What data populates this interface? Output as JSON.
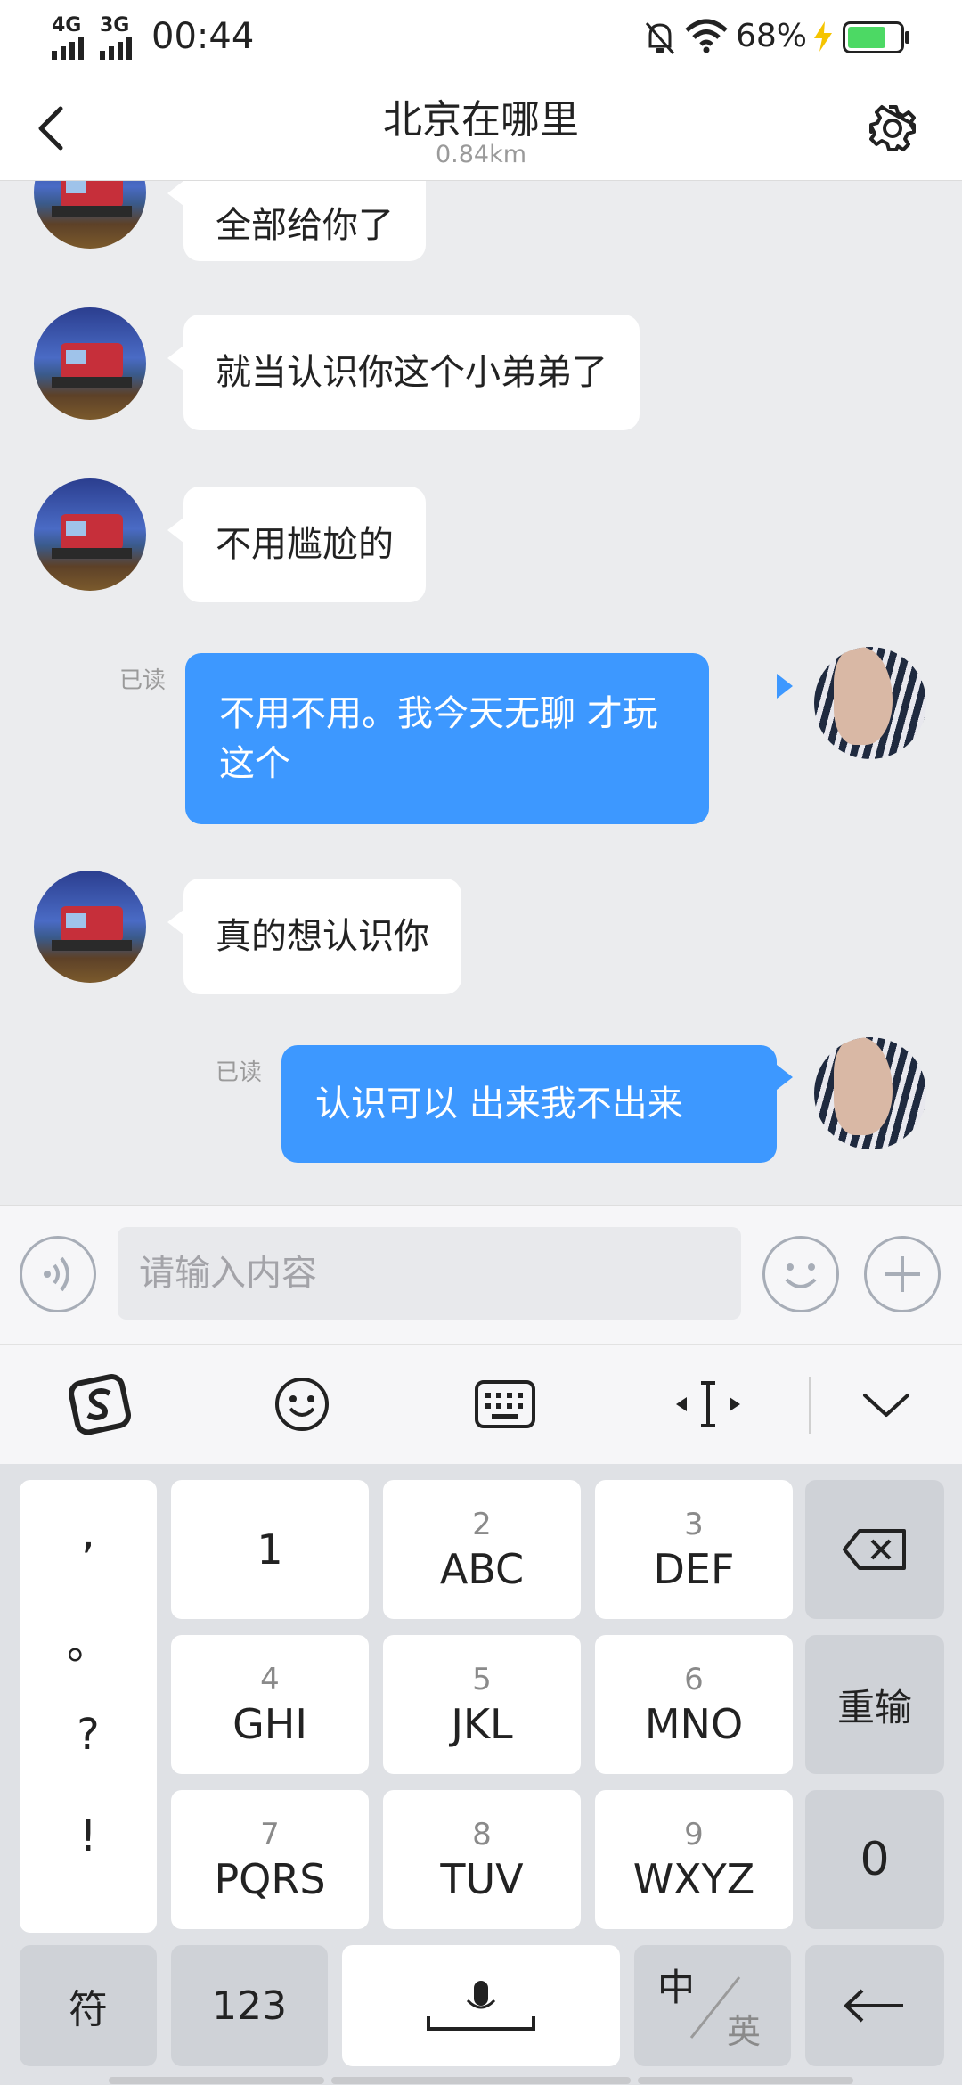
{
  "status_bar": {
    "signal1": "4G",
    "signal2": "3G",
    "time": "00:44",
    "battery_percent": "68%",
    "icons": [
      "bell-off-icon",
      "wifi-icon",
      "charging-icon",
      "battery-icon"
    ]
  },
  "header": {
    "title": "北京在哪里",
    "subtitle": "0.84km",
    "back_icon": "chevron-left-icon",
    "settings_icon": "gear-icon"
  },
  "messages": [
    {
      "side": "left",
      "text": "全部给你了"
    },
    {
      "side": "left",
      "text": "就当认识你这个小弟弟了"
    },
    {
      "side": "left",
      "text": "不用尴尬的"
    },
    {
      "side": "right",
      "status": "已读",
      "lines": [
        "不用不用。我今天无聊  才玩",
        "这个"
      ]
    },
    {
      "side": "left",
      "text": " 真的想认识你"
    },
    {
      "side": "right",
      "status": "已读",
      "text": "认识可以   出来我不出来"
    }
  ],
  "input_bar": {
    "placeholder": "请输入内容",
    "voice_icon": "voice-icon",
    "emoji_icon": "smiley-icon",
    "plus_icon": "plus-icon"
  },
  "keyboard_toolbar": [
    "sogou-logo-icon",
    "emoji-icon",
    "keyboard-icon",
    "cursor-move-icon",
    "chevron-down-icon"
  ],
  "keyboard": {
    "punct": [
      ",",
      "。",
      "?",
      "!"
    ],
    "keys": [
      {
        "num": "",
        "letters": "1"
      },
      {
        "num": "2",
        "letters": "ABC"
      },
      {
        "num": "3",
        "letters": "DEF"
      },
      {
        "num": "4",
        "letters": "GHI"
      },
      {
        "num": "5",
        "letters": "JKL"
      },
      {
        "num": "6",
        "letters": "MNO"
      },
      {
        "num": "7",
        "letters": "PQRS"
      },
      {
        "num": "8",
        "letters": "TUV"
      },
      {
        "num": "9",
        "letters": "WXYZ"
      }
    ],
    "reinput": "重输",
    "zero": "0",
    "symbols": "符",
    "num_mode": "123",
    "lang_zh": "中",
    "lang_en": "英"
  },
  "colors": {
    "accent": "#3d98ff",
    "chat_bg": "#ebecee",
    "battery_green": "#4cd964",
    "bolt_yellow": "#f5c400"
  }
}
